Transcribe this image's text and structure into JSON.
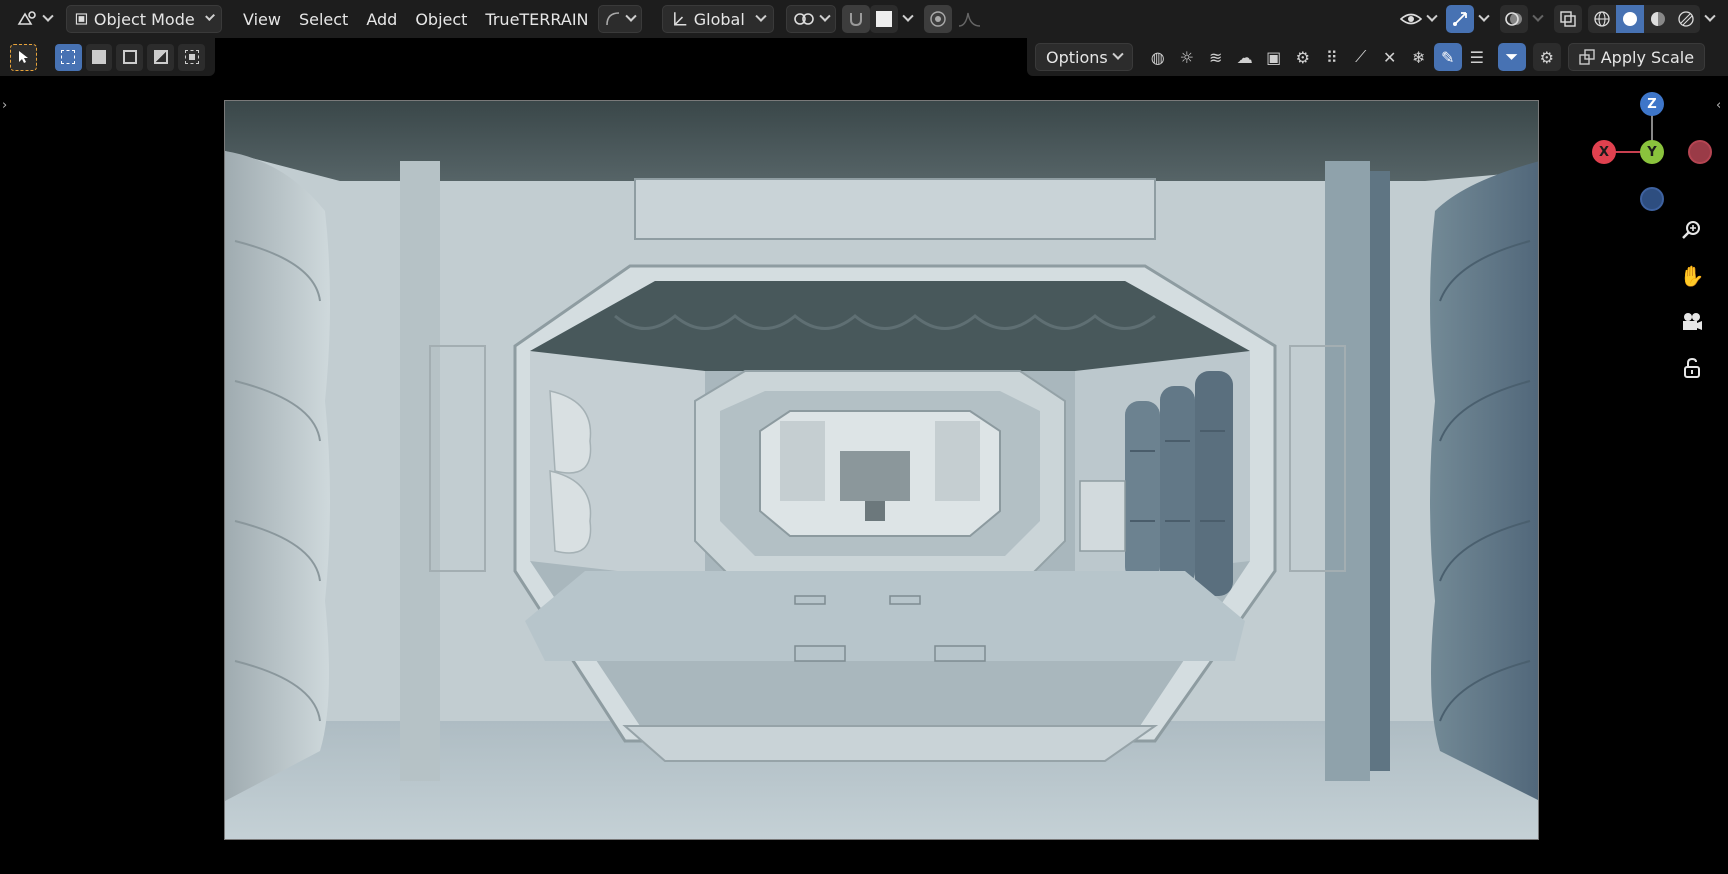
{
  "header": {
    "editor_type_icon": "viewport-editor-icon",
    "mode": "Object Mode",
    "menus": [
      "View",
      "Select",
      "Add",
      "Object",
      "TrueTERRAIN"
    ],
    "transform_orientation": "Global",
    "shading_modes": [
      "wireframe",
      "solid",
      "material-preview",
      "rendered"
    ]
  },
  "toolrow": {
    "select_tool_icon": "cursor-select-icon",
    "box_select_modes": [
      "set",
      "extend",
      "subtract",
      "invert",
      "intersect"
    ]
  },
  "rightrow": {
    "options_label": "Options",
    "apply_scale_label": "Apply Scale"
  },
  "gizmo": {
    "z_label": "Z",
    "y_label": "Y",
    "x_label": "X",
    "colors": {
      "x": "#e0414f",
      "y": "#8ac33d",
      "z": "#3e76c9"
    }
  },
  "scene": {
    "description_color_bg": "#b9c6cc"
  }
}
